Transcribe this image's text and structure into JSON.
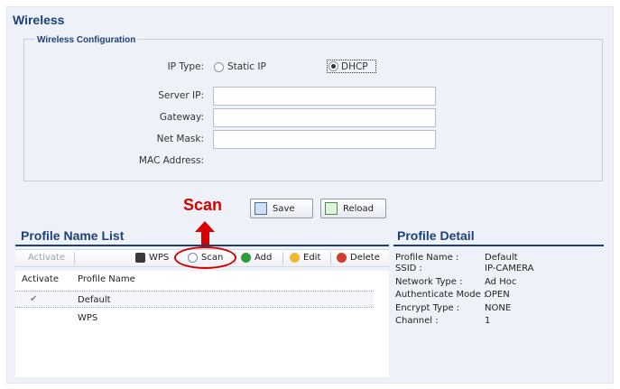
{
  "page": {
    "title": "Wireless"
  },
  "wireless_config": {
    "legend": "Wireless Configuration",
    "ip_type_label": "IP Type:",
    "static_ip_label": "Static IP",
    "dhcp_label": "DHCP",
    "selected_ip_type": "DHCP",
    "server_ip_label": "Server IP:",
    "server_ip_value": "",
    "gateway_label": "Gateway:",
    "gateway_value": "",
    "net_mask_label": "Net Mask:",
    "net_mask_value": "",
    "mac_address_label": "MAC Address:"
  },
  "annotation": {
    "text": "Scan",
    "color": "#d60000"
  },
  "buttons": {
    "save_label": "Save",
    "reload_label": "Reload"
  },
  "profile_list": {
    "title": "Profile Name List",
    "toolbar": {
      "activate": "Activate",
      "wps": "WPS",
      "scan": "Scan",
      "add": "Add",
      "edit": "Edit",
      "delete": "Delete"
    },
    "columns": [
      "Activate",
      "Profile Name"
    ],
    "rows": [
      {
        "active": true,
        "name": "Default"
      },
      {
        "active": false,
        "name": "WPS"
      }
    ]
  },
  "profile_detail": {
    "title": "Profile Detail",
    "fields": [
      {
        "label": "Profile Name :",
        "value": "Default"
      },
      {
        "label": "SSID :",
        "value": "IP-CAMERA"
      },
      {
        "label": "Network Type :",
        "value": "Ad Hoc"
      },
      {
        "label": "Authenticate Mode :",
        "value": "OPEN"
      },
      {
        "label": "Encrypt Type :",
        "value": "NONE"
      },
      {
        "label": "Channel :",
        "value": "1"
      }
    ]
  },
  "colors": {
    "heading": "#1c4179",
    "accent_red": "#d60000",
    "panel_bg": "#eef2f8"
  }
}
